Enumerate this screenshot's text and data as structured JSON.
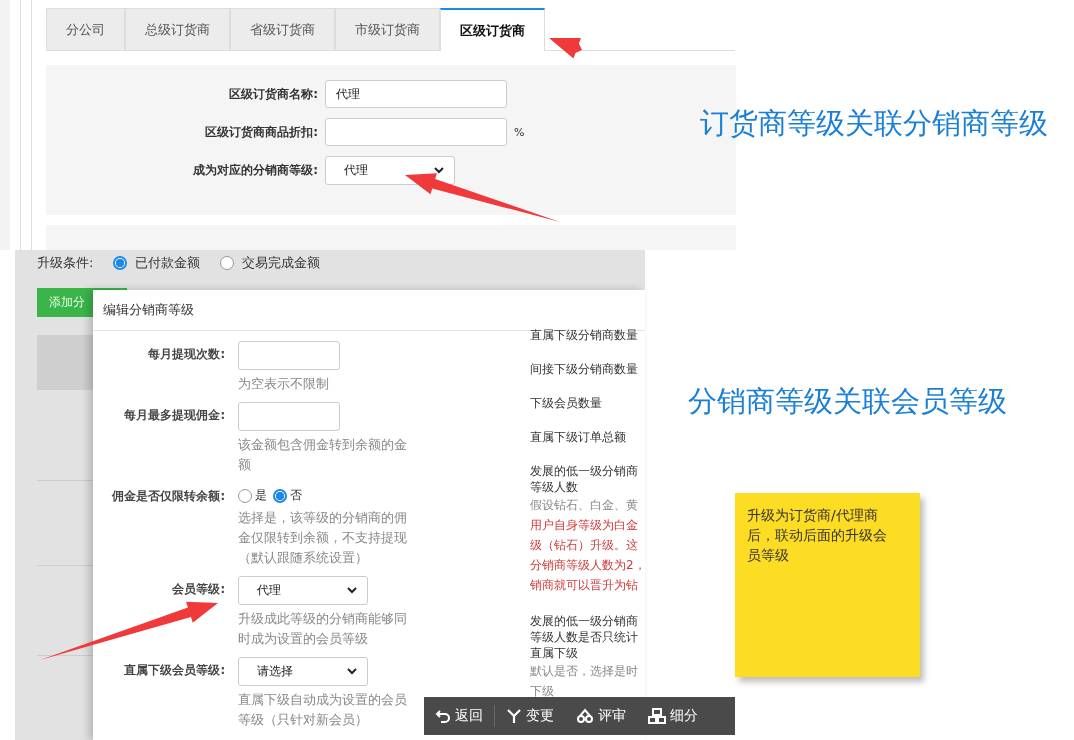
{
  "dealer_settings": {
    "tabs": [
      {
        "label": "分公司",
        "selected": false
      },
      {
        "label": "总级订货商",
        "selected": false
      },
      {
        "label": "省级订货商",
        "selected": false
      },
      {
        "label": "市级订货商",
        "selected": false
      },
      {
        "label": "区级订货商",
        "selected": true
      }
    ],
    "fields": [
      {
        "kind": "input",
        "label": "区级订货商名称:",
        "value": "代理"
      },
      {
        "kind": "input",
        "label": "区级订货商商品折扣:",
        "suffix": "%"
      },
      {
        "kind": "select",
        "label": "成为对应的分销商等级:",
        "value": "代理"
      }
    ]
  },
  "distributor_page": {
    "upgrade_condition": {
      "label": "升级条件:",
      "options": [
        {
          "label": "已付款金额",
          "selected": true
        },
        {
          "label": "交易完成金额",
          "selected": false
        }
      ]
    },
    "add_button": "添加分",
    "modal": {
      "title": "编辑分销商等级",
      "fields": [
        {
          "kind": "input",
          "label": "每月提现次数:",
          "hint": "为空表示不限制"
        },
        {
          "kind": "input",
          "label": "每月最多提现佣金:",
          "hint": "该金额包含佣金转到余额的金额"
        },
        {
          "kind": "radio",
          "label": "佣金是否仅限转余额:",
          "options": [
            {
              "label": "是",
              "selected": false
            },
            {
              "label": "否",
              "selected": true
            }
          ],
          "hint": "选择是，该等级的分销商的佣金仅限转到余额，不支持提现（默认跟随系统设置）"
        },
        {
          "kind": "select",
          "label": "会员等级:",
          "value": "代理",
          "hint": "升级成此等级的分销商能够同时成为设置的会员等级"
        },
        {
          "kind": "select",
          "label": "直属下级会员等级:",
          "value": "请选择",
          "hint": "直属下级自动成为设置的会员等级（只针对新会员）"
        }
      ],
      "right_column": [
        {
          "kind": "label",
          "text": "直属下级分销商数量"
        },
        {
          "kind": "label",
          "text": "间接下级分销商数量"
        },
        {
          "kind": "label",
          "text": "下级会员数量"
        },
        {
          "kind": "label",
          "text": "直属下级订单总额"
        },
        {
          "kind": "label",
          "text": "发展的低一级分销商等级人数"
        },
        {
          "kind": "hint",
          "text": "假设钻石、白金、黄"
        },
        {
          "kind": "warning",
          "text": "用户自身等级为白金"
        },
        {
          "kind": "warning",
          "text": "级（钻石）升级。这"
        },
        {
          "kind": "warning",
          "text": "分销商等级人数为2，"
        },
        {
          "kind": "warning",
          "text": "销商就可以晋升为钻"
        },
        {
          "kind": "label",
          "text": "发展的低一级分销商等级人数是否只统计直属下级"
        },
        {
          "kind": "hint",
          "text": "默认是否，选择是时"
        },
        {
          "kind": "hint",
          "text": "下级"
        }
      ]
    },
    "toolbar": [
      {
        "kind": "back",
        "label": "返回"
      },
      {
        "kind": "change",
        "label": "变更"
      },
      {
        "kind": "review",
        "label": "评审"
      },
      {
        "kind": "split",
        "label": "细分"
      }
    ]
  },
  "annotations": {
    "captions": [
      "订货商等级关联分销商等级",
      "分销商等级关联会员等级"
    ],
    "note": "升级为订货商/代理商后，联动后面的升级会员等级"
  }
}
